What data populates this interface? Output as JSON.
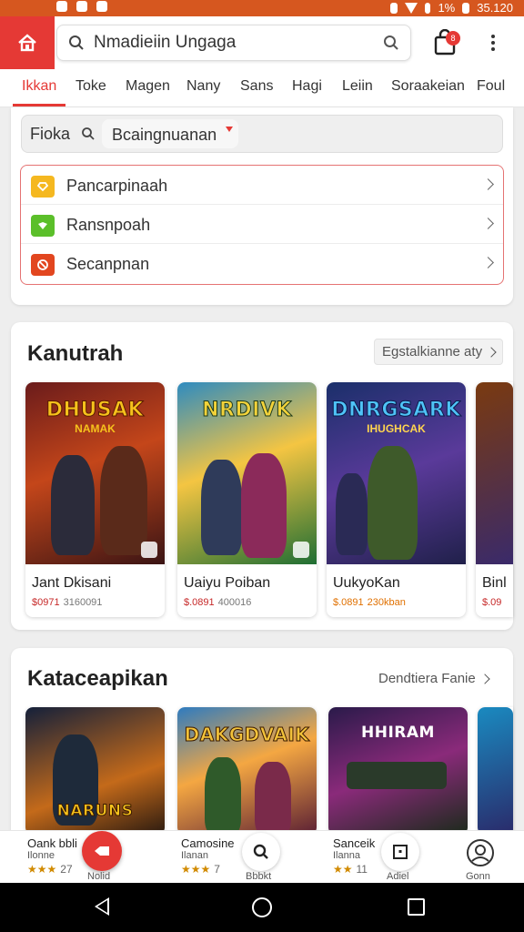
{
  "status_bar": {
    "battery_text": "1%",
    "time": "35.120"
  },
  "header": {
    "search_value": "Nmadieiin Ungaga",
    "bag_badge": "8"
  },
  "tabs": [
    {
      "label": "Ikkan"
    },
    {
      "label": "Toke"
    },
    {
      "label": "Magen"
    },
    {
      "label": "Nany"
    },
    {
      "label": "Sans"
    },
    {
      "label": "Hagi"
    },
    {
      "label": "Leiin"
    },
    {
      "label": "Soraakeian"
    },
    {
      "label": "Foul"
    }
  ],
  "filter": {
    "label": "Fioka",
    "selected": "Bcaingnuanan"
  },
  "menu": [
    {
      "label": "Pancarpinaah",
      "color": "#f5b820"
    },
    {
      "label": "Ransnpoah",
      "color": "#5bbf2a"
    },
    {
      "label": "Secanpnan",
      "color": "#e2461f"
    }
  ],
  "section1": {
    "title": "Kanutrah",
    "link": "Egstalkianne aty",
    "games": [
      {
        "name": "Jant Dkisani",
        "price": "$0971",
        "old": "3160091",
        "logo": "DHUSAK",
        "sub": "NAMAK"
      },
      {
        "name": "Uaiyu Poiban",
        "price": "$.0891",
        "old": "400016",
        "logo": "NRDIVK",
        "sub": ""
      },
      {
        "name": "UukyoKan",
        "price": "$.0891",
        "old": "230kban",
        "logo": "DNRGSARK",
        "sub": "IHUGHCAK"
      },
      {
        "name": "Binl",
        "price": "$.09",
        "old": "",
        "logo": "",
        "sub": ""
      }
    ]
  },
  "section2": {
    "title": "Kataceapikan",
    "link": "Dendtiera Fanie",
    "games": [
      {
        "logo": "NARUNS"
      },
      {
        "logo": "DAKGDVAIK"
      },
      {
        "logo": "HHIRAM"
      },
      {
        "logo": ""
      }
    ]
  },
  "bottom_strip": [
    {
      "name": "Oank bbli",
      "sub": "Ilonne",
      "stars": "★★★",
      "count": "27",
      "label": "Nolid"
    },
    {
      "name": "Camosine",
      "sub": "Ilanan",
      "stars": "★★★",
      "count": "7",
      "label": "Bbbkt"
    },
    {
      "name": "Sanceik",
      "sub": "Ilanna",
      "stars": "★★",
      "count": "11",
      "label": "Adiel"
    },
    {
      "label": "Gonn"
    }
  ]
}
